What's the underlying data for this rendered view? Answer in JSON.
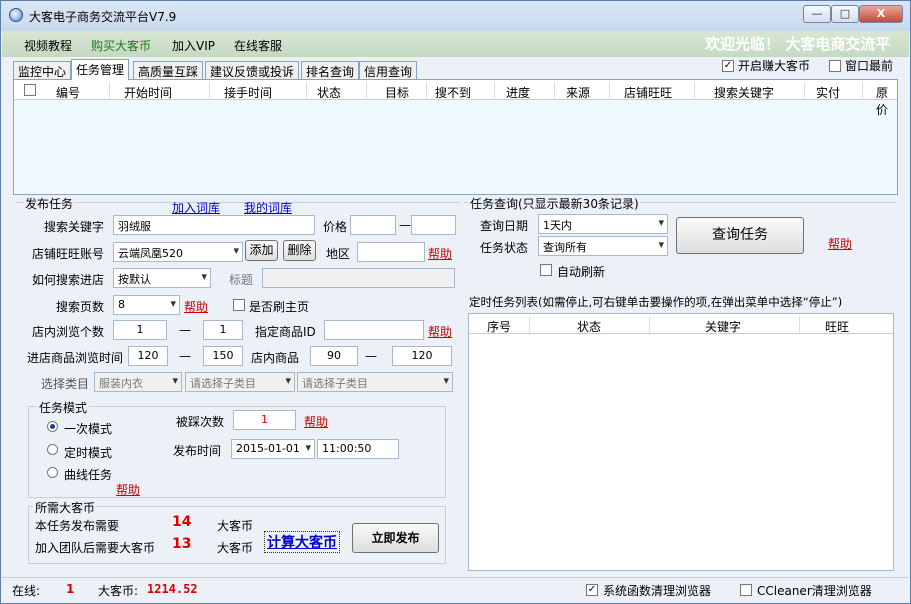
{
  "window": {
    "title": "大客电子商务交流平台V7.9",
    "min": "—",
    "max": "□",
    "close": "X"
  },
  "menu": {
    "items": [
      "视频教程",
      "购买大客币",
      "加入VIP",
      "在线客服"
    ],
    "welcome": "欢迎光临！ 大客电商交流平"
  },
  "tabs": [
    "监控中心",
    "任务管理",
    "高质量互踩",
    "建议反馈或投诉",
    "排名查询",
    "信用查询"
  ],
  "top_checks": {
    "earn": {
      "label": "开启赚大客币",
      "checked": "✓"
    },
    "topmost": {
      "label": "窗口最前"
    }
  },
  "task_grid": {
    "columns": [
      "编号",
      "开始时间",
      "接手时间",
      "状态",
      "目标",
      "搜不到",
      "进度",
      "来源",
      "店铺旺旺",
      "搜索关键字",
      "实付",
      "原价"
    ]
  },
  "publish": {
    "group_title": "发布任务",
    "add_lib_link": "加入词库",
    "my_lib_link": "我的词库",
    "keyword_label": "搜索关键字",
    "keyword_value": "羽绒服",
    "price_label": "价格",
    "price_dash": "—",
    "shop_label": "店铺旺旺账号",
    "shop_value": "云端凤凰520",
    "add_btn": "添加",
    "delete_btn": "删除",
    "region_label": "地区",
    "help": "帮助",
    "how_label": "如何搜索进店",
    "how_value": "按默认",
    "title_label": "标题",
    "pages_label": "搜索页数",
    "pages_value": "8",
    "brush_home_label": "是否刷主页",
    "browse_count_label": "店内浏览个数",
    "browse_from": "1",
    "browse_to": "1",
    "dash": "—",
    "goods_id_label": "指定商品ID",
    "enter_time_label": "进店商品浏览时间",
    "enter_from": "120",
    "enter_to": "150",
    "in_store_label": "店内商品",
    "in_store_from": "90",
    "in_store_to": "120",
    "category_label": "选择类目",
    "category_value": "服装内衣",
    "sub1": "请选择子类目",
    "sub2": "请选择子类目"
  },
  "mode": {
    "group_title": "任务模式",
    "once": "一次模式",
    "timed": "定时模式",
    "curve": "曲线任务",
    "help": "帮助",
    "step_count_label": "被踩次数",
    "step_count_value": "1",
    "step_help": "帮助",
    "publish_time_label": "发布时间",
    "date_value": "2015-01-01",
    "time_value": "11:00:50"
  },
  "coins": {
    "group_title": "所需大客币",
    "need_label": "本任务发布需要",
    "need_value": "14",
    "need_unit": "大客币",
    "team_label": "加入团队后需要大客币",
    "team_value": "13",
    "team_unit": "大客币",
    "calc_link": "计算大客币",
    "publish_btn": "立即发布"
  },
  "query": {
    "group_title": "任务查询(只显示最新30条记录)",
    "date_label": "查询日期",
    "date_value": "1天内",
    "status_label": "任务状态",
    "status_value": "查询所有",
    "query_btn": "查询任务",
    "help": "帮助",
    "auto_refresh": "自动刷新",
    "timed_list_label": "定时任务列表(如需停止,可右键单击要操作的项,在弹出菜单中选择“停止”)",
    "timed_columns": [
      "序号",
      "状态",
      "关键字",
      "旺旺"
    ]
  },
  "status": {
    "online_label": "在线:",
    "online_value": "1",
    "coins_label": "大客币:",
    "coins_value": "1214.52",
    "sys_clean_label": "系统函数清理浏览器",
    "sys_clean_checked": "✓",
    "ccleaner_label": "CCleaner清理浏览器"
  }
}
